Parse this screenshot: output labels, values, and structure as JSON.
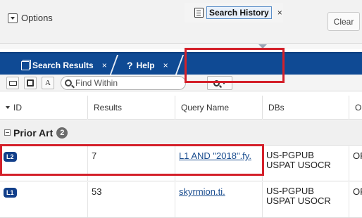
{
  "options": {
    "label": "Options",
    "clear_label": "Clear"
  },
  "tabs": [
    {
      "label": "Search Results",
      "close": "×"
    },
    {
      "label": "Help",
      "close": "×"
    },
    {
      "label": "Search History",
      "close": "×",
      "active": true
    }
  ],
  "toolbar": {
    "find_placeholder": "Find Within"
  },
  "grid": {
    "columns": [
      "ID",
      "Results",
      "Query Name",
      "DBs",
      "Op"
    ],
    "group": {
      "name": "Prior Art",
      "count": "2"
    },
    "rows": [
      {
        "id": "L2",
        "results": "7",
        "query": "L1 AND \"2018\".fy.",
        "dbs_line1": "US-PGPUB",
        "dbs_line2": "USPAT USOCR",
        "op": "OR"
      },
      {
        "id": "L1",
        "results": "53",
        "query": "skyrmion.ti.",
        "dbs_line1": "US-PGPUB",
        "dbs_line2": "USPAT USOCR",
        "op": "OR"
      }
    ]
  },
  "colors": {
    "tabstrip": "#0f4a94",
    "badge": "#123f8a",
    "highlight": "#d4202a",
    "link": "#1a4d8f"
  }
}
